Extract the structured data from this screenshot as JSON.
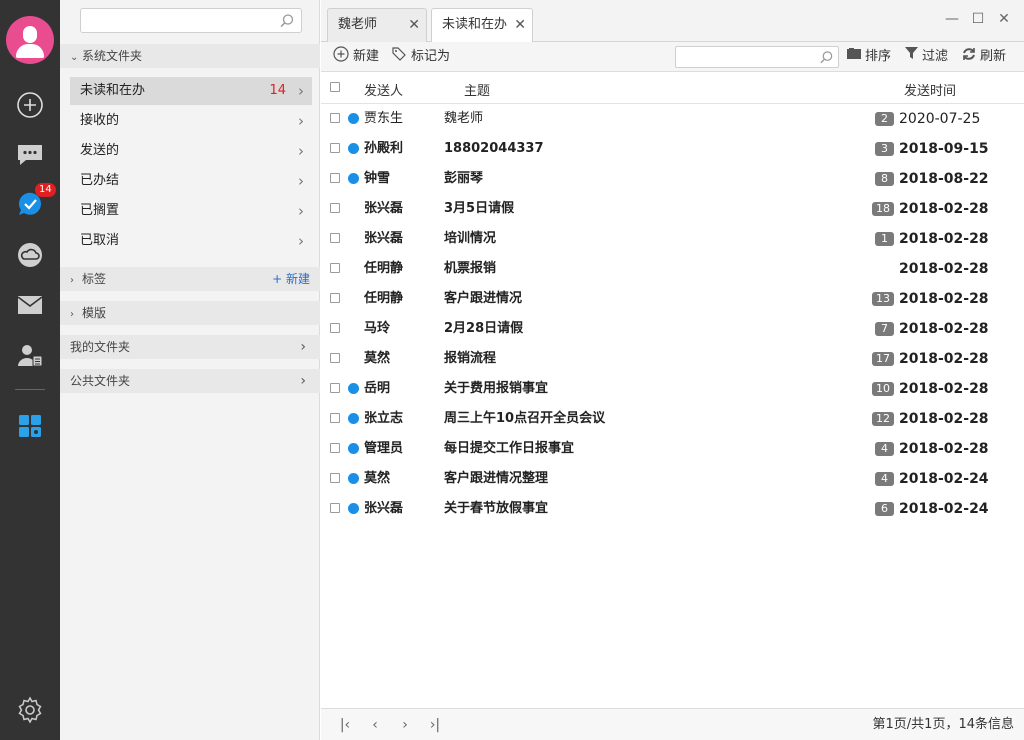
{
  "rail": {
    "badge": "14",
    "icons": [
      "avatar",
      "add-icon",
      "chat-icon",
      "task-check-icon",
      "cloud-icon",
      "mail-icon",
      "contacts-icon",
      "apps-icon",
      "settings-icon"
    ],
    "accent": "#1a8fe6",
    "avatar_color": "#e94d8f"
  },
  "folders": {
    "search_placeholder": "",
    "system_section": "系统文件夹",
    "items": [
      {
        "label": "未读和在办",
        "count": "14"
      },
      {
        "label": "接收的"
      },
      {
        "label": "发送的"
      },
      {
        "label": "已办结"
      },
      {
        "label": "已搁置"
      },
      {
        "label": "已取消"
      }
    ],
    "tags_section": "标签",
    "tags_new": "+ 新建",
    "templates_section": "模版",
    "my_folders": "我的文件夹",
    "public_folders": "公共文件夹"
  },
  "tabs": [
    {
      "label": "魏老师"
    },
    {
      "label": "未读和在办"
    }
  ],
  "toolbar": {
    "new_label": "新建",
    "mark_label": "标记为",
    "search_placeholder": "",
    "sort_label": "排序",
    "filter_label": "过滤",
    "refresh_label": "刷新"
  },
  "columns": {
    "sender": "发送人",
    "subject": "主题",
    "time": "发送时间"
  },
  "messages": [
    {
      "sender": "贾东生",
      "subject": "魏老师",
      "count": "2",
      "date": "2020-07-25",
      "dot": true,
      "unread": false
    },
    {
      "sender": "孙殿利",
      "subject": "18802044337",
      "count": "3",
      "date": "2018-09-15",
      "dot": true,
      "unread": true
    },
    {
      "sender": "钟雪",
      "subject": "彭丽琴",
      "count": "8",
      "date": "2018-08-22",
      "dot": true,
      "unread": true
    },
    {
      "sender": "张兴磊",
      "subject": "3月5日请假",
      "count": "18",
      "date": "2018-02-28",
      "dot": false,
      "unread": true
    },
    {
      "sender": "张兴磊",
      "subject": "培训情况",
      "count": "1",
      "date": "2018-02-28",
      "dot": false,
      "unread": true
    },
    {
      "sender": "任明静",
      "subject": "机票报销",
      "count": "",
      "date": "2018-02-28",
      "dot": false,
      "unread": true
    },
    {
      "sender": "任明静",
      "subject": "客户跟进情况",
      "count": "13",
      "date": "2018-02-28",
      "dot": false,
      "unread": true
    },
    {
      "sender": "马玲",
      "subject": "2月28日请假",
      "count": "7",
      "date": "2018-02-28",
      "dot": false,
      "unread": true
    },
    {
      "sender": "莫然",
      "subject": "报销流程",
      "count": "17",
      "date": "2018-02-28",
      "dot": false,
      "unread": true
    },
    {
      "sender": "岳明",
      "subject": "关于费用报销事宜",
      "count": "10",
      "date": "2018-02-28",
      "dot": true,
      "unread": true
    },
    {
      "sender": "张立志",
      "subject": "周三上午10点召开全员会议",
      "count": "12",
      "date": "2018-02-28",
      "dot": true,
      "unread": true
    },
    {
      "sender": "管理员",
      "subject": "每日提交工作日报事宜",
      "count": "4",
      "date": "2018-02-28",
      "dot": true,
      "unread": true
    },
    {
      "sender": "莫然",
      "subject": "客户跟进情况整理",
      "count": "4",
      "date": "2018-02-24",
      "dot": true,
      "unread": true
    },
    {
      "sender": "张兴磊",
      "subject": "关于春节放假事宜",
      "count": "6",
      "date": "2018-02-24",
      "dot": true,
      "unread": true
    }
  ],
  "footer": {
    "page_info": "第1页/共1页，14条信息"
  }
}
